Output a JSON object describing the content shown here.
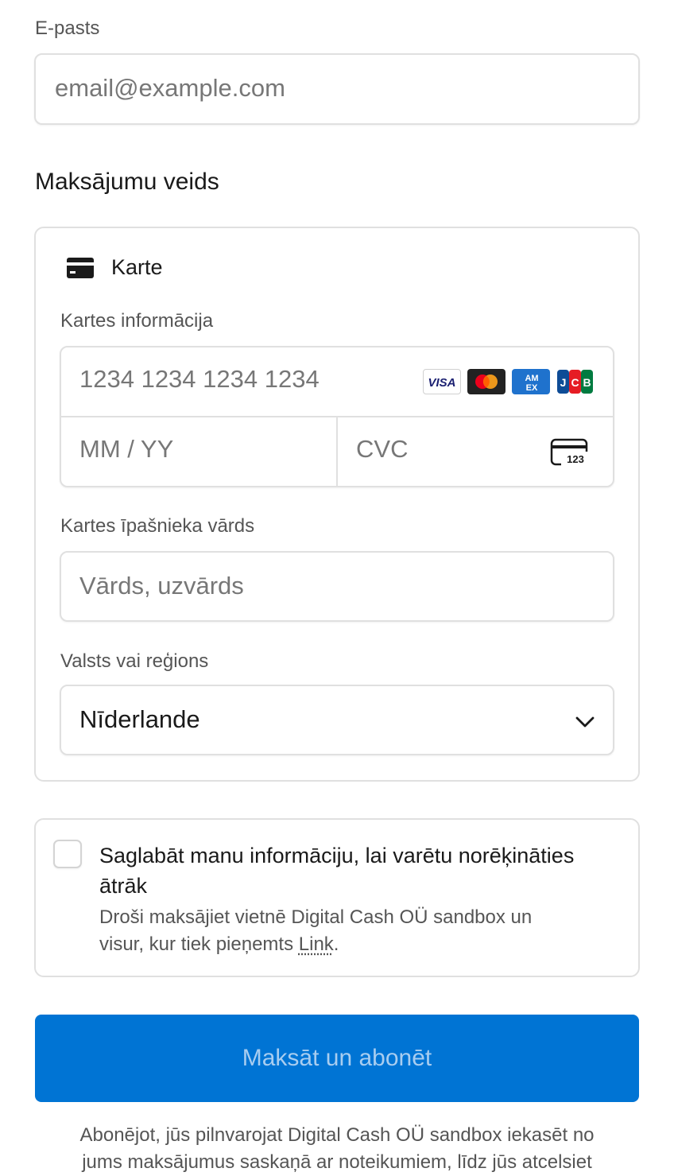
{
  "email": {
    "label": "E-pasts",
    "placeholder": "email@example.com"
  },
  "payment_method": {
    "heading": "Maksājumu veids",
    "tab": {
      "icon": "credit-card-icon",
      "label": "Karte"
    },
    "card_info": {
      "label": "Kartes informācija",
      "number_placeholder": "1234 1234 1234 1234",
      "brands": [
        "VISA",
        "Mastercard",
        "American Express",
        "JCB"
      ],
      "expiry_placeholder": "MM / YY",
      "cvc_placeholder": "CVC",
      "cvc_icon_text": "123"
    },
    "cardholder": {
      "label": "Kartes īpašnieka vārds",
      "placeholder": "Vārds, uzvārds"
    },
    "country": {
      "label": "Valsts vai reģions",
      "selected": "Nīderlande"
    }
  },
  "save_info": {
    "title_line1": "Saglabāt manu informāciju, lai varētu norēķināties",
    "title_line2": "ātrāk",
    "desc_line1": "Droši maksājiet vietnē Digital Cash OÜ sandbox un",
    "desc_line2_prefix": "visur, kur tiek pieņemts ",
    "desc_link": "Link",
    "desc_line2_suffix": "."
  },
  "submit": {
    "label": "Maksāt un abonēt"
  },
  "terms": {
    "line1": "Abonējot, jūs pilnvarojat Digital Cash OÜ sandbox iekasēt no",
    "line2": "jums maksājumus saskaņā ar noteikumiem, līdz jūs atcelsiet"
  },
  "colors": {
    "primary": "#0074d4",
    "border": "#e0e0e0",
    "placeholder": "#777777",
    "label": "#555555"
  }
}
